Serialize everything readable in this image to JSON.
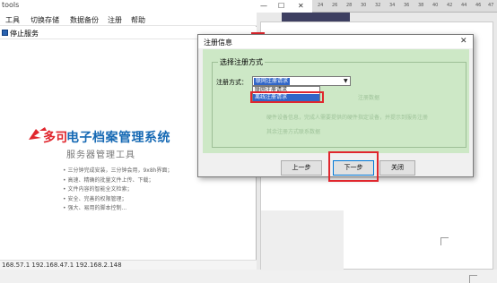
{
  "app": {
    "title": "tools",
    "menus": [
      "工具",
      "切换存储",
      "数据备份",
      "注册",
      "帮助"
    ],
    "toolbar_stop": "停止服务",
    "logo_text": "多可",
    "brand_title": "电子档案管理系统",
    "brand_subtitle": "服务器管理工具",
    "features": [
      "• 三分钟完成安装，三分钟会用，9x8h界面；",
      "• 高速、精确的批量文件上传、下载；",
      "• 文件内容的智能全文检索；",
      "• 安全、完善的权限管理；",
      "• 强大、易用的脚本控制..."
    ],
    "status_ips": "168.57.1  192.168.47.1  192.168.2.148",
    "colors": {
      "brand_blue": "#1669b4",
      "logo_red": "#e0262d"
    }
  },
  "docwin": {
    "window_controls": [
      "—",
      "☐",
      "✕"
    ],
    "ruler_ticks": [
      "24",
      "26",
      "28",
      "30",
      "32",
      "34",
      "36",
      "38",
      "40",
      "42",
      "44",
      "46",
      "47"
    ]
  },
  "dialog": {
    "title": "注册信息",
    "close_glyph": "✕",
    "group_title": "选择注册方式",
    "method_label": "注册方式：",
    "method_selected": "联网注册请求",
    "options": [
      "联网注册请求",
      "离线注册请求"
    ],
    "hints": [
      "注册数据",
      "硬件设备信息，完成人需要提供的硬件指定设备，并提示到服务注册",
      "其余注册方式联系数据"
    ],
    "buttons": {
      "prev": "上一步",
      "next": "下一步",
      "close": "关闭"
    },
    "colors": {
      "body_bg": "#cde8c6",
      "highlight": "#e0262d",
      "selection": "#3166c8"
    }
  }
}
